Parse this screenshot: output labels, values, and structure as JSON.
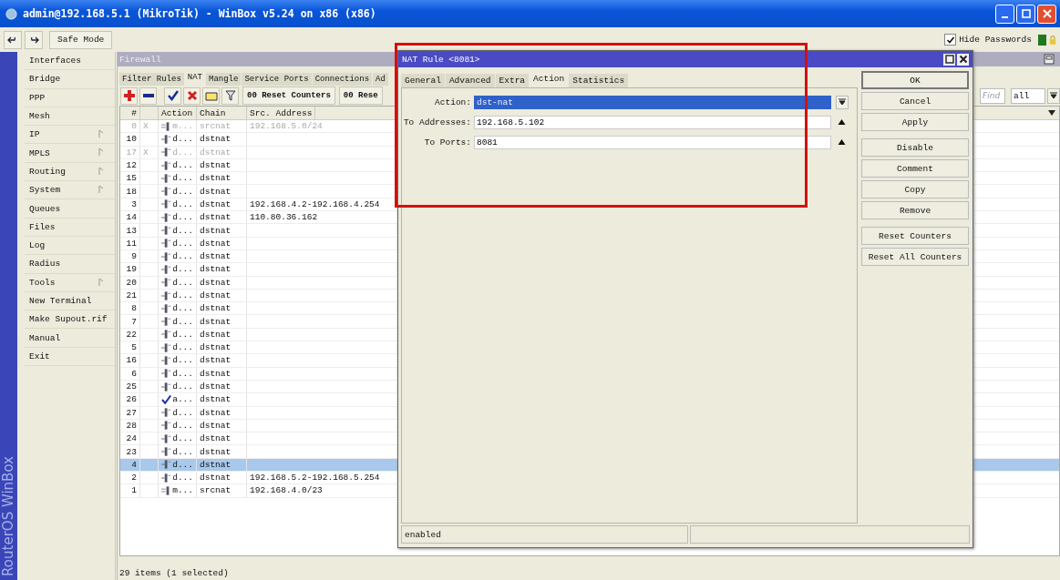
{
  "window": {
    "title": "admin@192.168.5.1 (MikroTik) - WinBox v5.24 on x86 (x86)"
  },
  "toolbar": {
    "safe_mode": "Safe Mode",
    "hide_passwords": {
      "label": "Hide Passwords",
      "checked": true
    }
  },
  "brand": "RouterOS WinBox",
  "sidebar": {
    "items": [
      {
        "label": "Interfaces",
        "submenu": false
      },
      {
        "label": "Bridge",
        "submenu": false
      },
      {
        "label": "PPP",
        "submenu": false
      },
      {
        "label": "Mesh",
        "submenu": false
      },
      {
        "label": "IP",
        "submenu": true
      },
      {
        "label": "MPLS",
        "submenu": true
      },
      {
        "label": "Routing",
        "submenu": true
      },
      {
        "label": "System",
        "submenu": true
      },
      {
        "label": "Queues",
        "submenu": false
      },
      {
        "label": "Files",
        "submenu": false
      },
      {
        "label": "Log",
        "submenu": false
      },
      {
        "label": "Radius",
        "submenu": false
      },
      {
        "label": "Tools",
        "submenu": true
      },
      {
        "label": "New Terminal",
        "submenu": false
      },
      {
        "label": "Make Supout.rif",
        "submenu": false
      },
      {
        "label": "Manual",
        "submenu": false
      },
      {
        "label": "Exit",
        "submenu": false
      }
    ]
  },
  "firewall": {
    "title": "Firewall",
    "tabs": [
      {
        "label": "Filter Rules",
        "selected": false
      },
      {
        "label": "NAT",
        "selected": true
      },
      {
        "label": "Mangle",
        "selected": false
      },
      {
        "label": "Service Ports",
        "selected": false
      },
      {
        "label": "Connections",
        "selected": false
      },
      {
        "label": "Ad",
        "selected": false
      }
    ],
    "buttons": [
      "00 Reset Counters",
      "00 Rese"
    ],
    "find": {
      "placeholder": "Find"
    },
    "filter": "all",
    "table": {
      "columns": [
        "#",
        "Action",
        "Chain",
        "Src. Address"
      ],
      "rows": [
        {
          "num": "0",
          "flag": "X",
          "kind": "masquerade",
          "action": "m...",
          "chain": "srcnat",
          "src": "192.168.5.0/24",
          "disabled": true,
          "selected": false
        },
        {
          "num": "10",
          "kind": "dstnat",
          "action": "d...",
          "chain": "dstnat",
          "disabled": false,
          "selected": false
        },
        {
          "num": "17",
          "flag": "X",
          "kind": "dstnat",
          "action": "d...",
          "chain": "dstnat",
          "disabled": true,
          "selected": false
        },
        {
          "num": "12",
          "kind": "dstnat",
          "action": "d...",
          "chain": "dstnat",
          "disabled": false,
          "selected": false
        },
        {
          "num": "15",
          "kind": "dstnat",
          "action": "d...",
          "chain": "dstnat",
          "disabled": false,
          "selected": false
        },
        {
          "num": "18",
          "kind": "dstnat",
          "action": "d...",
          "chain": "dstnat",
          "disabled": false,
          "selected": false
        },
        {
          "num": "3",
          "kind": "dstnat",
          "action": "d...",
          "chain": "dstnat",
          "src": "192.168.4.2-192.168.4.254",
          "disabled": false,
          "selected": false
        },
        {
          "num": "14",
          "kind": "dstnat",
          "action": "d...",
          "chain": "dstnat",
          "src": "110.80.36.162",
          "disabled": false,
          "selected": false
        },
        {
          "num": "13",
          "kind": "dstnat",
          "action": "d...",
          "chain": "dstnat",
          "disabled": false,
          "selected": false
        },
        {
          "num": "11",
          "kind": "dstnat",
          "action": "d...",
          "chain": "dstnat",
          "disabled": false,
          "selected": false
        },
        {
          "num": "9",
          "kind": "dstnat",
          "action": "d...",
          "chain": "dstnat",
          "disabled": false,
          "selected": false
        },
        {
          "num": "19",
          "kind": "dstnat",
          "action": "d...",
          "chain": "dstnat",
          "disabled": false,
          "selected": false
        },
        {
          "num": "20",
          "kind": "dstnat",
          "action": "d...",
          "chain": "dstnat",
          "disabled": false,
          "selected": false
        },
        {
          "num": "21",
          "kind": "dstnat",
          "action": "d...",
          "chain": "dstnat",
          "disabled": false,
          "selected": false
        },
        {
          "num": "8",
          "kind": "dstnat",
          "action": "d...",
          "chain": "dstnat",
          "disabled": false,
          "selected": false
        },
        {
          "num": "7",
          "kind": "dstnat",
          "action": "d...",
          "chain": "dstnat",
          "disabled": false,
          "selected": false
        },
        {
          "num": "22",
          "kind": "dstnat",
          "action": "d...",
          "chain": "dstnat",
          "disabled": false,
          "selected": false
        },
        {
          "num": "5",
          "kind": "dstnat",
          "action": "d...",
          "chain": "dstnat",
          "disabled": false,
          "selected": false
        },
        {
          "num": "16",
          "kind": "dstnat",
          "action": "d...",
          "chain": "dstnat",
          "disabled": false,
          "selected": false
        },
        {
          "num": "6",
          "kind": "dstnat",
          "action": "d...",
          "chain": "dstnat",
          "disabled": false,
          "selected": false
        },
        {
          "num": "25",
          "kind": "dstnat",
          "action": "d...",
          "chain": "dstnat",
          "disabled": false,
          "selected": false
        },
        {
          "num": "26",
          "kind": "accept",
          "action": "a...",
          "chain": "dstnat",
          "disabled": false,
          "selected": false
        },
        {
          "num": "27",
          "kind": "dstnat",
          "action": "d...",
          "chain": "dstnat",
          "disabled": false,
          "selected": false
        },
        {
          "num": "28",
          "kind": "dstnat",
          "action": "d...",
          "chain": "dstnat",
          "disabled": false,
          "selected": false
        },
        {
          "num": "24",
          "kind": "dstnat",
          "action": "d...",
          "chain": "dstnat",
          "disabled": false,
          "selected": false
        },
        {
          "num": "23",
          "kind": "dstnat",
          "action": "d...",
          "chain": "dstnat",
          "disabled": false,
          "selected": false
        },
        {
          "num": "4",
          "kind": "dstnat",
          "action": "d...",
          "chain": "dstnat",
          "disabled": false,
          "selected": true
        },
        {
          "num": "2",
          "kind": "dstnat",
          "action": "d...",
          "chain": "dstnat",
          "src": "192.168.5.2-192.168.5.254",
          "disabled": false,
          "selected": false
        },
        {
          "num": "1",
          "kind": "masquerade",
          "action": "m...",
          "chain": "srcnat",
          "src": "192.168.4.0/23",
          "disabled": false,
          "selected": false
        }
      ]
    },
    "status": "29 items (1 selected)"
  },
  "dialog": {
    "title": "NAT Rule <8081>",
    "tabs": [
      {
        "label": "General",
        "selected": false
      },
      {
        "label": "Advanced",
        "selected": false
      },
      {
        "label": "Extra",
        "selected": false
      },
      {
        "label": "Action",
        "selected": true
      },
      {
        "label": "Statistics",
        "selected": false
      }
    ],
    "fields": [
      {
        "label": "Action:",
        "kind": "select",
        "value": "dst-nat"
      },
      {
        "label": "To Addresses:",
        "kind": "text",
        "value": "192.168.5.102"
      },
      {
        "label": "To Ports:",
        "kind": "text",
        "value": "8081"
      }
    ],
    "button_groups": [
      [
        "OK",
        "Cancel",
        "Apply"
      ],
      [
        "Disable",
        "Comment",
        "Copy",
        "Remove"
      ],
      [
        "Reset Counters",
        "Reset All Counters"
      ]
    ],
    "status": "enabled"
  }
}
